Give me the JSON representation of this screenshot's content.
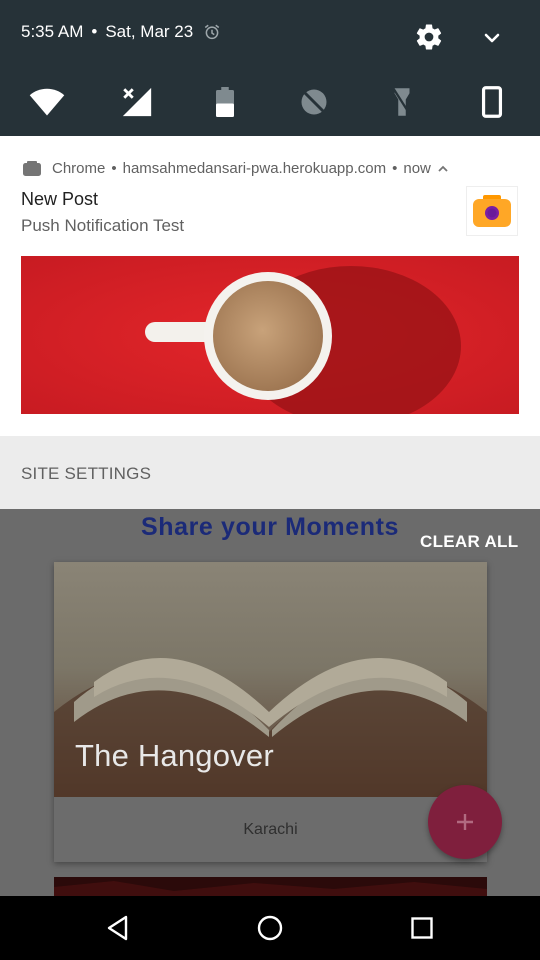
{
  "status": {
    "time": "5:35 AM",
    "separator": "•",
    "date": "Sat, Mar 23"
  },
  "icons": {
    "alarm": "alarm-icon",
    "settings": "gear-icon",
    "expand": "chevron-down-icon",
    "tiles": [
      "wifi-icon",
      "cellular-no-signal-icon",
      "battery-icon",
      "do-not-disturb-icon",
      "flashlight-icon",
      "rotation-icon"
    ]
  },
  "notification": {
    "app_name": "Chrome",
    "sep1": "•",
    "origin": "hamsahmedansari-pwa.herokuapp.com",
    "sep2": "•",
    "time": "now",
    "title": "New Post",
    "text": "Push Notification Test",
    "large_icon": "camera-icon",
    "image": "coffee-cup-on-red-image",
    "action": "SITE SETTINGS"
  },
  "app": {
    "heading": "Share your Moments",
    "clear_all": "CLEAR ALL",
    "card": {
      "title": "The Hangover",
      "location": "Karachi",
      "image": "open-book-image"
    },
    "fab": "plus-icon"
  },
  "navbar": {
    "back": "back-icon",
    "home": "home-icon",
    "recents": "recents-icon"
  },
  "colors": {
    "qs_background": "#263238",
    "notification_background": "#ffffff",
    "image_background": "#d71f24",
    "heading": "#1b2a78",
    "fab": "#e91e63",
    "app_icon": "#ff9800"
  }
}
